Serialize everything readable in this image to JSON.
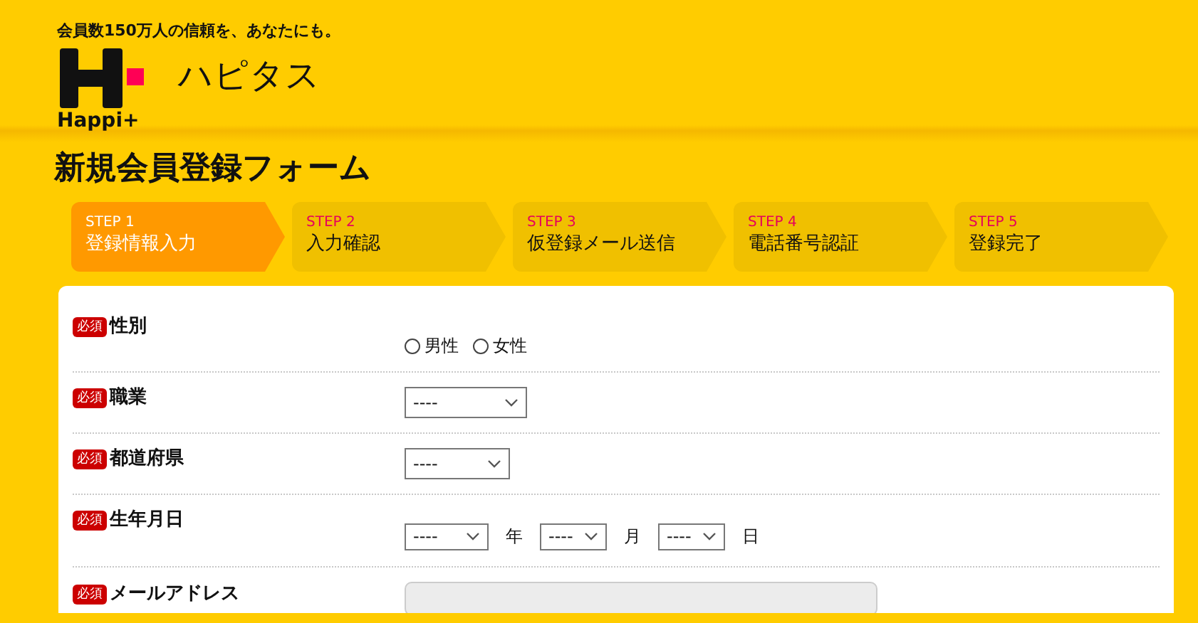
{
  "header": {
    "tagline": "会員数150万人の信頼を、あなたにも。",
    "logo_text": "Happi+",
    "site_name": "ハピタス"
  },
  "title": "新規会員登録フォーム",
  "steps": [
    {
      "number": "STEP 1",
      "label": "登録情報入力",
      "selected": true
    },
    {
      "number": "STEP 2",
      "label": "入力確認",
      "selected": false
    },
    {
      "number": "STEP 3",
      "label": "仮登録メール送信",
      "selected": false
    },
    {
      "number": "STEP 4",
      "label": "電話番号認証",
      "selected": false
    },
    {
      "number": "STEP 5",
      "label": "登録完了",
      "selected": false
    }
  ],
  "form": {
    "rows": [
      {
        "kind": "radio",
        "badge": "必須",
        "label": "性別",
        "options": [
          {
            "label": "男性",
            "selected": false
          },
          {
            "label": "女性",
            "selected": false
          }
        ]
      },
      {
        "kind": "select",
        "badge": "必須",
        "label": "職業",
        "value": "----"
      },
      {
        "kind": "select",
        "badge": "必須",
        "label": "都道府県",
        "value": "----"
      },
      {
        "kind": "date",
        "badge": "必須",
        "label": "生年月日",
        "parts": [
          {
            "value": "----",
            "unit": "年"
          },
          {
            "value": "----",
            "unit": "月"
          },
          {
            "value": "----",
            "unit": "日"
          }
        ]
      },
      {
        "kind": "text",
        "badge": "必須",
        "label": "メールアドレス"
      }
    ]
  }
}
